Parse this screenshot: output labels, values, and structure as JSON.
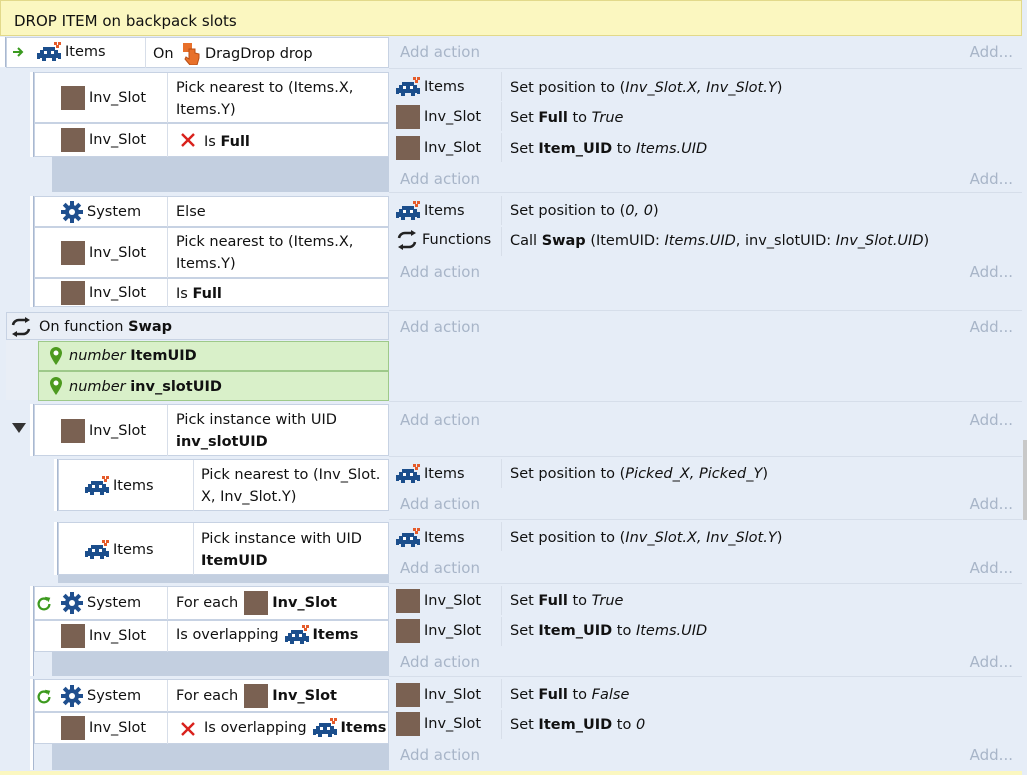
{
  "group": {
    "title": "DROP ITEM on backpack slots"
  },
  "add_action": "Add action",
  "add_more": "Add...",
  "event1": {
    "object": "Items",
    "trigger_prefix": "On",
    "trigger": "DragDrop drop"
  },
  "sub1": {
    "cond1_obj": "Inv_Slot",
    "cond1_text": "Pick nearest to (Items.X,",
    "cond1_text2": "Items.Y)",
    "cond2_obj": "Inv_Slot",
    "cond2_prefix": "Is",
    "cond2_bold": "Full",
    "actions": [
      {
        "obj": "Items",
        "pre": "Set position to (",
        "it": "Inv_Slot.X, Inv_Slot.Y",
        "post": ")"
      },
      {
        "obj": "Inv_Slot",
        "pre": "Set",
        "bold": "Full",
        "mid": "to",
        "it": "True"
      },
      {
        "obj": "Inv_Slot",
        "pre": "Set",
        "bold": "Item_UID",
        "mid": "to",
        "it": "Items.UID"
      }
    ]
  },
  "sub2": {
    "cond1_obj": "System",
    "cond1_text": "Else",
    "cond2_obj": "Inv_Slot",
    "cond2_text": "Pick nearest to (Items.X,",
    "cond2_text2": "Items.Y)",
    "cond3_obj": "Inv_Slot",
    "cond3_prefix": "Is",
    "cond3_bold": "Full",
    "act1_obj": "Items",
    "act1_pre": "Set position to (",
    "act1_it": "0, 0",
    "act1_post": ")",
    "act2_obj": "Functions",
    "act2_pre": "Call",
    "act2_bold": "Swap",
    "act2_p1": "(ItemUID:",
    "act2_i1": "Items.UID",
    "act2_p2": ", inv_slotUID:",
    "act2_i2": "Inv_Slot.UID",
    "act2_p3": ")"
  },
  "func": {
    "prefix": "On function",
    "name": "Swap",
    "params": [
      {
        "type": "number",
        "name": "ItemUID"
      },
      {
        "type": "number",
        "name": "inv_slotUID"
      }
    ]
  },
  "sub3": {
    "cond_obj": "Inv_Slot",
    "cond_text": "Pick instance with UID",
    "cond_bold": "inv_slotUID"
  },
  "sub3a": {
    "cond_obj": "Items",
    "cond_text": "Pick nearest to (Inv_Slot.",
    "cond_text2": "X, Inv_Slot.Y)",
    "act_obj": "Items",
    "act_pre": "Set position to (",
    "act_it": "Picked_X, Picked_Y",
    "act_post": ")"
  },
  "sub3b": {
    "cond_obj": "Items",
    "cond_text": "Pick instance with UID",
    "cond_bold": "ItemUID",
    "act_obj": "Items",
    "act_pre": "Set position to (",
    "act_it": "Inv_Slot.X, Inv_Slot.Y",
    "act_post": ")"
  },
  "sub4": {
    "cond1_obj": "System",
    "cond1_pre": "For each",
    "cond1_bold": "Inv_Slot",
    "cond2_obj": "Inv_Slot",
    "cond2_pre": "Is overlapping",
    "cond2_bold": "Items",
    "act1_obj": "Inv_Slot",
    "act1_pre": "Set",
    "act1_bold": "Full",
    "act1_mid": "to",
    "act1_it": "True",
    "act2_obj": "Inv_Slot",
    "act2_pre": "Set",
    "act2_bold": "Item_UID",
    "act2_mid": "to",
    "act2_it": "Items.UID"
  },
  "sub5": {
    "cond1_obj": "System",
    "cond1_pre": "For each",
    "cond1_bold": "Inv_Slot",
    "cond2_obj": "Inv_Slot",
    "cond2_pre": "Is overlapping",
    "cond2_bold": "Items",
    "act1_obj": "Inv_Slot",
    "act1_pre": "Set",
    "act1_bold": "Full",
    "act1_mid": "to",
    "act1_it": "False",
    "act2_obj": "Inv_Slot",
    "act2_pre": "Set",
    "act2_bold": "Item_UID",
    "act2_mid": "to",
    "act2_it": "0"
  },
  "colors": {
    "group_bg": "#fbf7c0",
    "condition_bg": "#ffffff",
    "param_bg": "#d9f0c9",
    "slot_icon": "#7a6152"
  }
}
